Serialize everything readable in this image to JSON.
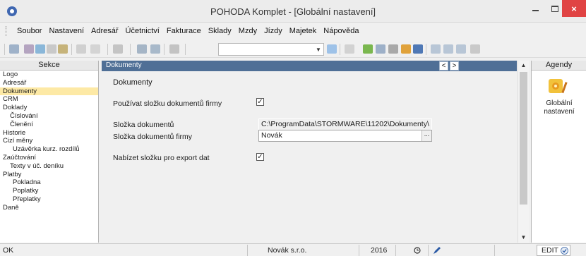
{
  "window": {
    "title": "POHODA Komplet - [Globální nastavení]",
    "close_glyph": "×"
  },
  "menu": {
    "items": [
      "Soubor",
      "Nastavení",
      "Adresář",
      "Účetnictví",
      "Fakturace",
      "Sklady",
      "Mzdy",
      "Jízdy",
      "Majetek",
      "Nápověda"
    ]
  },
  "sections": {
    "header": "Sekce",
    "items": [
      {
        "label": "Logo",
        "level": 0
      },
      {
        "label": "Adresář",
        "level": 0
      },
      {
        "label": "Dokumenty",
        "level": 0,
        "active": true
      },
      {
        "label": "CRM",
        "level": 0
      },
      {
        "label": "Doklady",
        "level": 0
      },
      {
        "label": "Číslování",
        "level": 1
      },
      {
        "label": "Členění",
        "level": 1
      },
      {
        "label": "Historie",
        "level": 0
      },
      {
        "label": "Cizí měny",
        "level": 0
      },
      {
        "label": "Uzávěrka kurz. rozdílů",
        "level": 2
      },
      {
        "label": "Zaúčtování",
        "level": 0
      },
      {
        "label": "Texty v úč. deníku",
        "level": 1
      },
      {
        "label": "Platby",
        "level": 0
      },
      {
        "label": "Pokladna",
        "level": 2
      },
      {
        "label": "Poplatky",
        "level": 2
      },
      {
        "label": "Přeplatky",
        "level": 2
      },
      {
        "label": "Daně",
        "level": 0
      }
    ]
  },
  "main": {
    "header_title": "Dokumenty",
    "nav_prev": "<",
    "nav_next": ">",
    "section_title": "Dokumenty",
    "use_company_folder_label": "Používat složku dokumentů firmy",
    "use_company_folder_checked": true,
    "docs_folder_label": "Složka dokumentů",
    "docs_folder_value": "C:\\ProgramData\\STORMWARE\\11202\\Dokumenty\\",
    "company_folder_label": "Složka dokumentů firmy",
    "company_folder_value": "Novák",
    "browse_glyph": "...",
    "export_folder_label": "Nabízet složku pro export dat",
    "export_folder_checked": true,
    "check_glyph": "✓"
  },
  "agendas": {
    "header": "Agendy",
    "item_label_line1": "Globální",
    "item_label_line2": "nastavení"
  },
  "status": {
    "left": "OK",
    "company": "Novák s.r.o.",
    "year": "2016",
    "edit": "EDIT"
  },
  "colors": {
    "header_blue": "#4f6f96",
    "active_item": "#fde9a5",
    "close_red": "#e04343"
  }
}
